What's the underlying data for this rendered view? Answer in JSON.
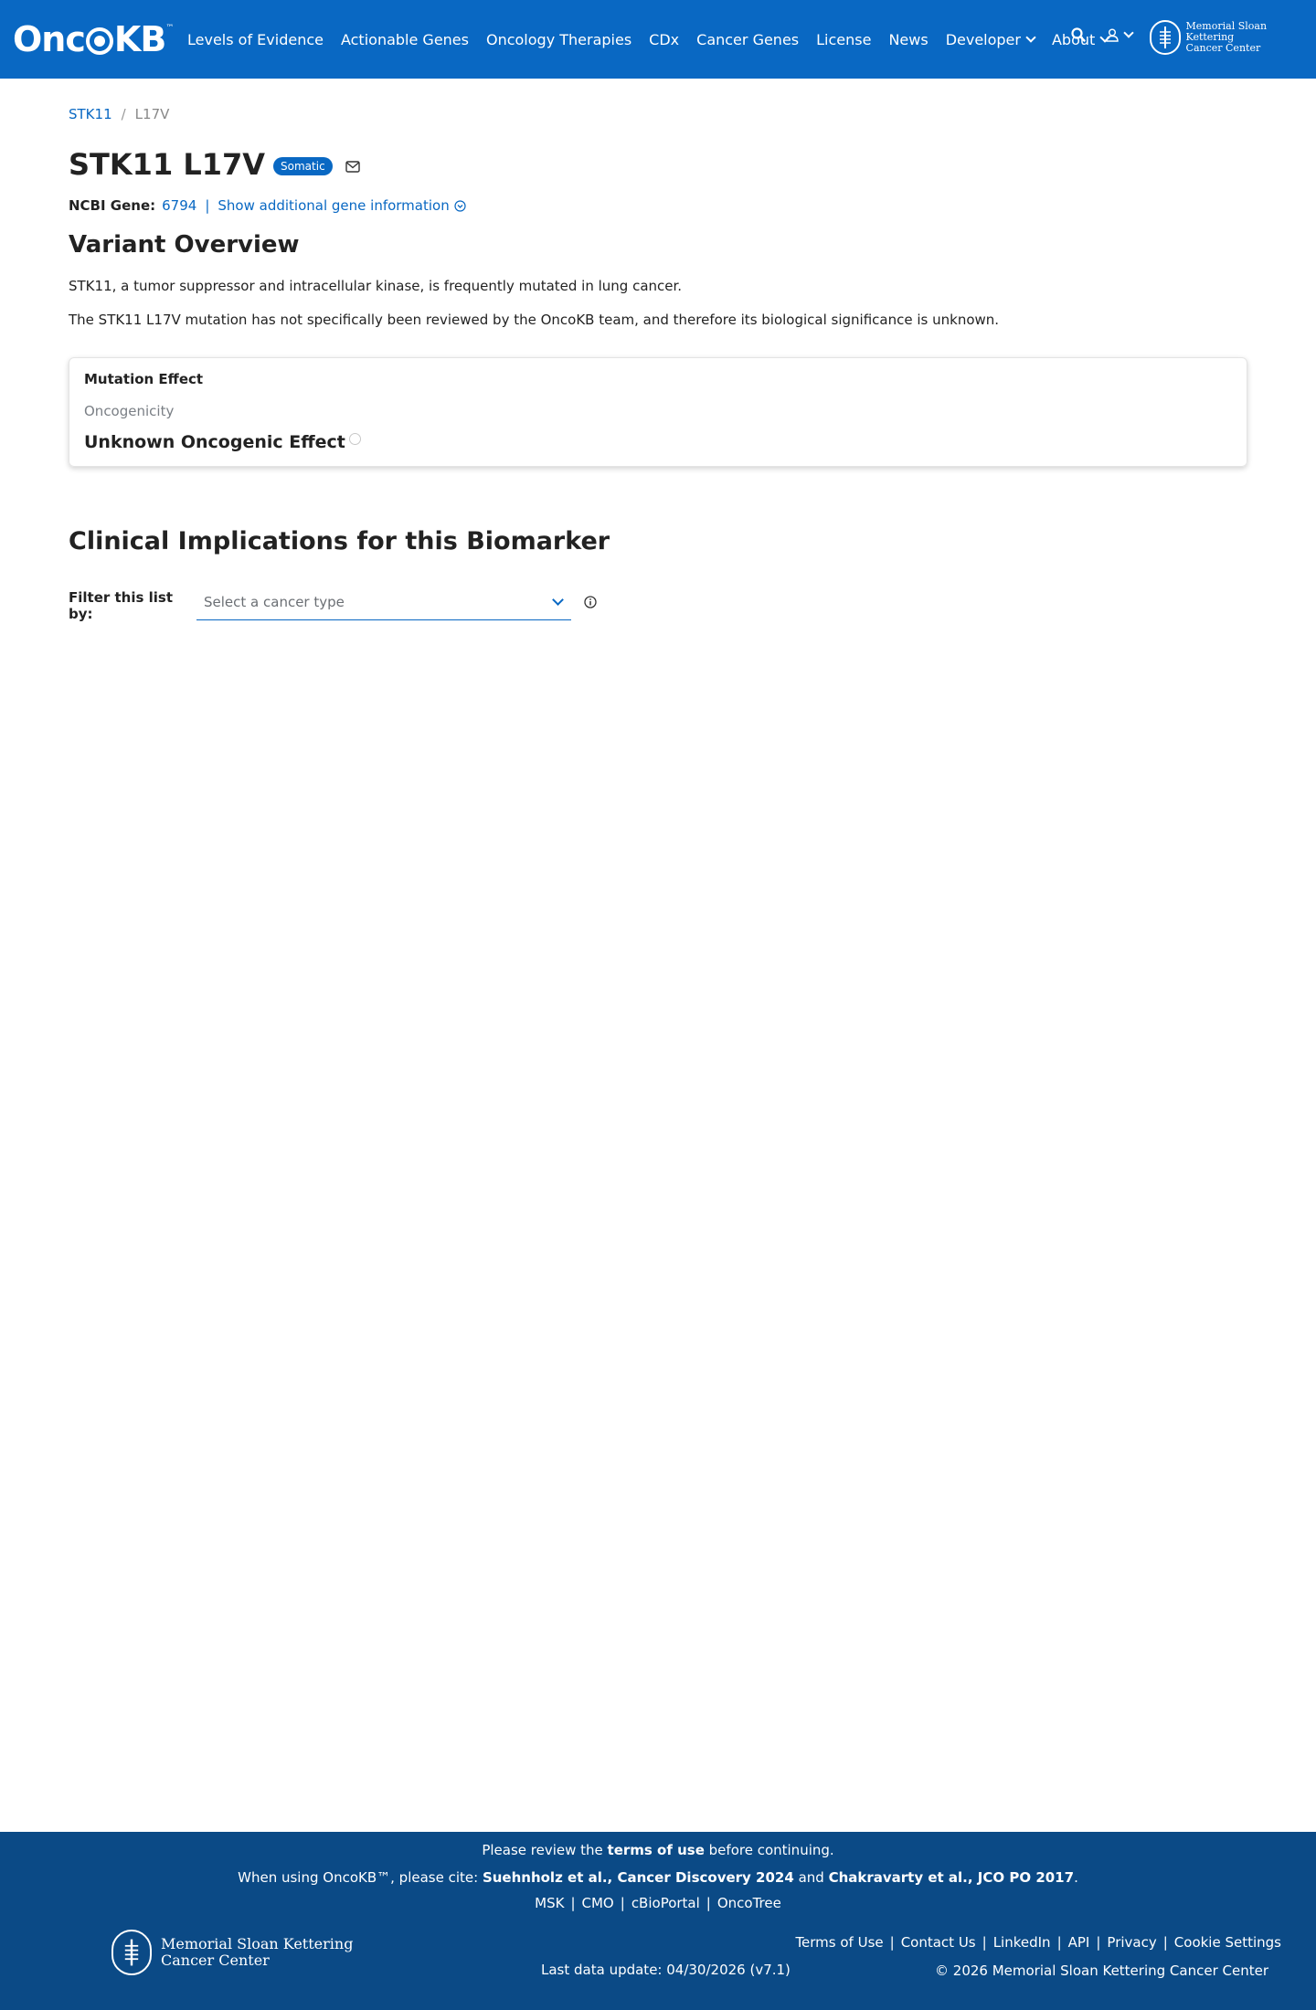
{
  "header": {
    "logo_text_left": "Onc",
    "logo_text_right": "KB",
    "logo_tm": "™",
    "nav": [
      {
        "label": "Levels of Evidence"
      },
      {
        "label": "Actionable Genes"
      },
      {
        "label": "Oncology Therapies"
      },
      {
        "label": "CDx"
      },
      {
        "label": "Cancer Genes"
      },
      {
        "label": "License"
      },
      {
        "label": "News"
      },
      {
        "label": "Developer"
      },
      {
        "label": "About"
      }
    ],
    "msk_line1": "Memorial Sloan Kettering",
    "msk_line2": "Cancer Center"
  },
  "breadcrumb": {
    "gene": "STK11",
    "sep": "/",
    "variant": "L17V"
  },
  "title": {
    "text": "STK11 L17V",
    "badge": "Somatic"
  },
  "gene_info": {
    "label": "NCBI Gene:",
    "id": "6794",
    "pipe": "|",
    "more_link": "Show additional gene information"
  },
  "overview": {
    "heading": "Variant Overview",
    "p1": "STK11, a tumor suppressor and intracellular kinase, is frequently mutated in lung cancer.",
    "p2": "The STK11 L17V mutation has not specifically been reviewed by the OncoKB team, and therefore its biological significance is unknown."
  },
  "mutation_effect": {
    "title": "Mutation Effect",
    "subtitle": "Oncogenicity",
    "value": "Unknown Oncogenic Effect"
  },
  "clinical": {
    "heading": "Clinical Implications for this Biomarker",
    "filter_label": "Filter this list by:",
    "select_placeholder": "Select a cancer type"
  },
  "footer": {
    "review_pre": "Please review the ",
    "review_link": "terms of use",
    "review_post": " before continuing.",
    "cite_pre": "When using OncoKB™, please cite: ",
    "cite1": "Suehnholz et al., Cancer Discovery 2024",
    "cite_and": " and ",
    "cite2": "Chakravarty et al., JCO PO 2017",
    "cite_post": ".",
    "links_top": [
      "MSK",
      "CMO",
      "cBioPortal",
      "OncoTree"
    ],
    "msk_line1": "Memorial Sloan Kettering",
    "msk_line2": "Cancer Center",
    "last_update": "Last data update: 04/30/2026 (v7.1)",
    "links_right": [
      "Terms of Use",
      "Contact Us",
      "LinkedIn",
      "API",
      "Privacy",
      "Cookie Settings"
    ],
    "copyright": "© 2026 Memorial Sloan Kettering Cancer Center",
    "sep": "|"
  },
  "colors": {
    "brand_blue": "#0968c3",
    "footer_blue": "#0b4a86"
  }
}
